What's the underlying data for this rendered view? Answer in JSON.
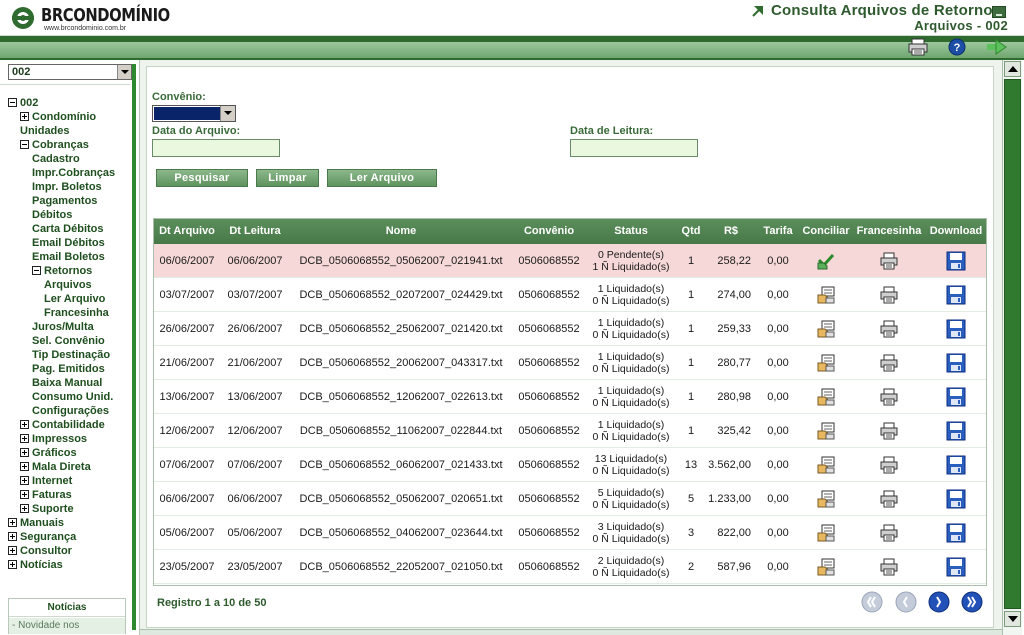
{
  "header": {
    "logo_text": "BRCONDOMÍNIO",
    "logo_url": "www.brcondominio.com.br",
    "title": "Consulta Arquivos de Retorno",
    "subtitle": "Arquivos - 002"
  },
  "toolbar": {
    "icons": [
      "print-icon",
      "help-icon",
      "exit-arrow-icon"
    ]
  },
  "sidebar": {
    "condominio_select": "002",
    "tree": [
      {
        "label": "002",
        "toggle": "minus",
        "level": 0
      },
      {
        "label": "Condomínio",
        "toggle": "plus",
        "level": 1
      },
      {
        "label": "Unidades",
        "toggle": "",
        "level": 1
      },
      {
        "label": "Cobranças",
        "toggle": "minus",
        "level": 1
      },
      {
        "label": "Cadastro",
        "toggle": "",
        "level": 2
      },
      {
        "label": "Impr.Cobranças",
        "toggle": "",
        "level": 2
      },
      {
        "label": "Impr. Boletos",
        "toggle": "",
        "level": 2
      },
      {
        "label": "Pagamentos",
        "toggle": "",
        "level": 2
      },
      {
        "label": "Débitos",
        "toggle": "",
        "level": 2
      },
      {
        "label": "Carta Débitos",
        "toggle": "",
        "level": 2
      },
      {
        "label": "Email Débitos",
        "toggle": "",
        "level": 2
      },
      {
        "label": "Email Boletos",
        "toggle": "",
        "level": 2
      },
      {
        "label": "Retornos",
        "toggle": "minus",
        "level": 2
      },
      {
        "label": "Arquivos",
        "toggle": "",
        "level": 3
      },
      {
        "label": "Ler Arquivo",
        "toggle": "",
        "level": 3
      },
      {
        "label": "Francesinha",
        "toggle": "",
        "level": 3
      },
      {
        "label": "Juros/Multa",
        "toggle": "",
        "level": 2
      },
      {
        "label": "Sel. Convênio",
        "toggle": "",
        "level": 2
      },
      {
        "label": "Tip Destinação",
        "toggle": "",
        "level": 2
      },
      {
        "label": "Pag. Emitidos",
        "toggle": "",
        "level": 2
      },
      {
        "label": "Baixa Manual",
        "toggle": "",
        "level": 2
      },
      {
        "label": "Consumo Unid.",
        "toggle": "",
        "level": 2
      },
      {
        "label": "Configurações",
        "toggle": "",
        "level": 2
      },
      {
        "label": "Contabilidade",
        "toggle": "plus",
        "level": 1
      },
      {
        "label": "Impressos",
        "toggle": "plus",
        "level": 1
      },
      {
        "label": "Gráficos",
        "toggle": "plus",
        "level": 1
      },
      {
        "label": "Mala Direta",
        "toggle": "plus",
        "level": 1
      },
      {
        "label": "Internet",
        "toggle": "plus",
        "level": 1
      },
      {
        "label": "Faturas",
        "toggle": "plus",
        "level": 1
      },
      {
        "label": "Suporte",
        "toggle": "plus",
        "level": 1
      },
      {
        "label": "Manuais",
        "toggle": "plus",
        "level": 0
      },
      {
        "label": "Segurança",
        "toggle": "plus",
        "level": 0
      },
      {
        "label": "Consultor",
        "toggle": "plus",
        "level": 0
      },
      {
        "label": "Notícias",
        "toggle": "plus",
        "level": 0
      }
    ],
    "news": {
      "title": "Notícias",
      "item": "- Novidade nos"
    }
  },
  "form": {
    "convenio_label": "Convênio:",
    "data_arquivo_label": "Data do Arquivo:",
    "data_arquivo_value": "",
    "data_leitura_label": "Data de Leitura:",
    "data_leitura_value": "",
    "buttons": {
      "pesquisar": "Pesquisar",
      "limpar": "Limpar",
      "ler_arquivo": "Ler Arquivo"
    }
  },
  "table": {
    "columns": [
      "Dt Arquivo",
      "Dt Leitura",
      "Nome",
      "Convênio",
      "Status",
      "Qtd",
      "R$",
      "Tarifa",
      "Conciliar",
      "Francesinha",
      "Download"
    ],
    "rows": [
      {
        "dt_arquivo": "06/06/2007",
        "dt_leitura": "06/06/2007",
        "nome": "DCB_0506068552_05062007_021941.txt",
        "convenio": "0506068552",
        "status1": "0 Pendente(s)",
        "status2": "1 Ñ Liquidado(s)",
        "qtd": "1",
        "valor": "258,22",
        "tarifa": "0,00",
        "conciliar_icon": "conciliar-done-icon",
        "highlight": true
      },
      {
        "dt_arquivo": "03/07/2007",
        "dt_leitura": "03/07/2007",
        "nome": "DCB_0506068552_02072007_024429.txt",
        "convenio": "0506068552",
        "status1": "1 Liquidado(s)",
        "status2": "0 Ñ Liquidado(s)",
        "qtd": "1",
        "valor": "274,00",
        "tarifa": "0,00",
        "conciliar_icon": "conciliar-icon",
        "highlight": false
      },
      {
        "dt_arquivo": "26/06/2007",
        "dt_leitura": "26/06/2007",
        "nome": "DCB_0506068552_25062007_021420.txt",
        "convenio": "0506068552",
        "status1": "1 Liquidado(s)",
        "status2": "0 Ñ Liquidado(s)",
        "qtd": "1",
        "valor": "259,33",
        "tarifa": "0,00",
        "conciliar_icon": "conciliar-icon",
        "highlight": false
      },
      {
        "dt_arquivo": "21/06/2007",
        "dt_leitura": "21/06/2007",
        "nome": "DCB_0506068552_20062007_043317.txt",
        "convenio": "0506068552",
        "status1": "1 Liquidado(s)",
        "status2": "0 Ñ Liquidado(s)",
        "qtd": "1",
        "valor": "280,77",
        "tarifa": "0,00",
        "conciliar_icon": "conciliar-icon",
        "highlight": false
      },
      {
        "dt_arquivo": "13/06/2007",
        "dt_leitura": "13/06/2007",
        "nome": "DCB_0506068552_12062007_022613.txt",
        "convenio": "0506068552",
        "status1": "1 Liquidado(s)",
        "status2": "0 Ñ Liquidado(s)",
        "qtd": "1",
        "valor": "280,98",
        "tarifa": "0,00",
        "conciliar_icon": "conciliar-icon",
        "highlight": false
      },
      {
        "dt_arquivo": "12/06/2007",
        "dt_leitura": "12/06/2007",
        "nome": "DCB_0506068552_11062007_022844.txt",
        "convenio": "0506068552",
        "status1": "1 Liquidado(s)",
        "status2": "0 Ñ Liquidado(s)",
        "qtd": "1",
        "valor": "325,42",
        "tarifa": "0,00",
        "conciliar_icon": "conciliar-icon",
        "highlight": false
      },
      {
        "dt_arquivo": "07/06/2007",
        "dt_leitura": "07/06/2007",
        "nome": "DCB_0506068552_06062007_021433.txt",
        "convenio": "0506068552",
        "status1": "13 Liquidado(s)",
        "status2": "0 Ñ Liquidado(s)",
        "qtd": "13",
        "valor": "3.562,00",
        "tarifa": "0,00",
        "conciliar_icon": "conciliar-icon",
        "highlight": false
      },
      {
        "dt_arquivo": "06/06/2007",
        "dt_leitura": "06/06/2007",
        "nome": "DCB_0506068552_05062007_020651.txt",
        "convenio": "0506068552",
        "status1": "5 Liquidado(s)",
        "status2": "0 Ñ Liquidado(s)",
        "qtd": "5",
        "valor": "1.233,00",
        "tarifa": "0,00",
        "conciliar_icon": "conciliar-icon",
        "highlight": false
      },
      {
        "dt_arquivo": "05/06/2007",
        "dt_leitura": "05/06/2007",
        "nome": "DCB_0506068552_04062007_023644.txt",
        "convenio": "0506068552",
        "status1": "3 Liquidado(s)",
        "status2": "0 Ñ Liquidado(s)",
        "qtd": "3",
        "valor": "822,00",
        "tarifa": "0,00",
        "conciliar_icon": "conciliar-icon",
        "highlight": false
      },
      {
        "dt_arquivo": "23/05/2007",
        "dt_leitura": "23/05/2007",
        "nome": "DCB_0506068552_22052007_021050.txt",
        "convenio": "0506068552",
        "status1": "2 Liquidado(s)",
        "status2": "0 Ñ Liquidado(s)",
        "qtd": "2",
        "valor": "587,96",
        "tarifa": "0,00",
        "conciliar_icon": "conciliar-icon",
        "highlight": false
      }
    ]
  },
  "pagination": {
    "info": "Registro 1 a 10 de 50",
    "buttons": [
      "first-page-icon",
      "prev-page-icon",
      "next-page-icon",
      "last-page-icon"
    ]
  },
  "colors": {
    "brand_green": "#2f6b2f",
    "header_green": "#477847",
    "highlight_row": "#f6d8d8",
    "input_fill": "#eaf8e0"
  }
}
